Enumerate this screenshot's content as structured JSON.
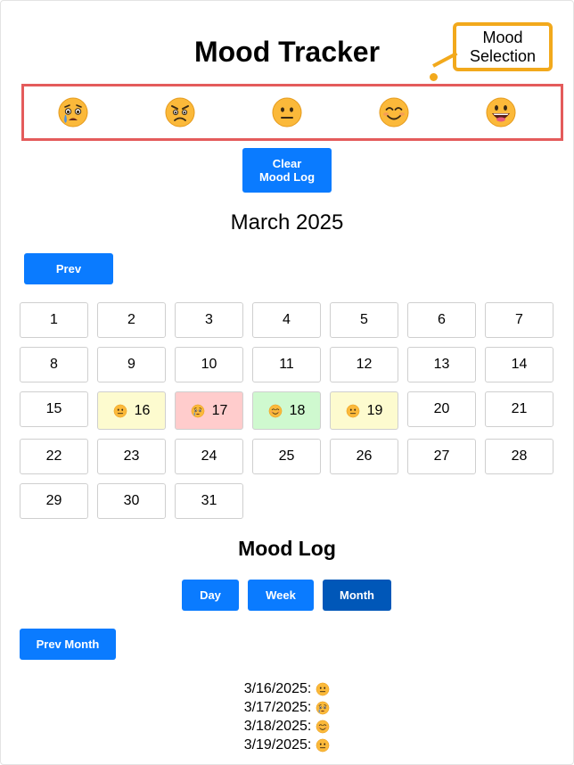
{
  "app": {
    "title": "Mood Tracker",
    "callout": "Mood Selection"
  },
  "moods": [
    {
      "name": "sad",
      "icon": "crying-face-icon"
    },
    {
      "name": "angry",
      "icon": "angry-face-icon"
    },
    {
      "name": "neutral",
      "icon": "neutral-face-icon"
    },
    {
      "name": "happy",
      "icon": "smiling-face-icon"
    },
    {
      "name": "excited",
      "icon": "grinning-face-icon"
    }
  ],
  "controls": {
    "clear_label": "Clear\nMood Log",
    "prev_label": "Prev",
    "prev_month_label": "Prev Month"
  },
  "calendar": {
    "month_label": "March 2025",
    "days": [
      {
        "day": "1"
      },
      {
        "day": "2"
      },
      {
        "day": "3"
      },
      {
        "day": "4"
      },
      {
        "day": "5"
      },
      {
        "day": "6"
      },
      {
        "day": "7"
      },
      {
        "day": "8"
      },
      {
        "day": "9"
      },
      {
        "day": "10"
      },
      {
        "day": "11"
      },
      {
        "day": "12"
      },
      {
        "day": "13"
      },
      {
        "day": "14"
      },
      {
        "day": "15"
      },
      {
        "day": "16",
        "mood": "neutral"
      },
      {
        "day": "17",
        "mood": "sad"
      },
      {
        "day": "18",
        "mood": "happy"
      },
      {
        "day": "19",
        "mood": "neutral"
      },
      {
        "day": "20"
      },
      {
        "day": "21"
      },
      {
        "day": "22"
      },
      {
        "day": "23"
      },
      {
        "day": "24"
      },
      {
        "day": "25"
      },
      {
        "day": "26"
      },
      {
        "day": "27"
      },
      {
        "day": "28"
      },
      {
        "day": "29"
      },
      {
        "day": "30"
      },
      {
        "day": "31"
      }
    ]
  },
  "mood_colors": {
    "neutral": "#fdfbcf",
    "sad": "#ffcccc",
    "happy": "#cff9cf"
  },
  "mood_log": {
    "title": "Mood Log",
    "views": [
      {
        "label": "Day",
        "active": false
      },
      {
        "label": "Week",
        "active": false
      },
      {
        "label": "Month",
        "active": true
      }
    ],
    "entries": [
      {
        "date": "3/16/2025:",
        "mood": "neutral"
      },
      {
        "date": "3/17/2025:",
        "mood": "sad"
      },
      {
        "date": "3/18/2025:",
        "mood": "happy"
      },
      {
        "date": "3/19/2025:",
        "mood": "neutral"
      }
    ]
  },
  "colors": {
    "accent": "#0a7bff",
    "accent_active": "#0057b8",
    "highlight_border": "#e45b5b",
    "callout_border": "#f2a91c"
  }
}
